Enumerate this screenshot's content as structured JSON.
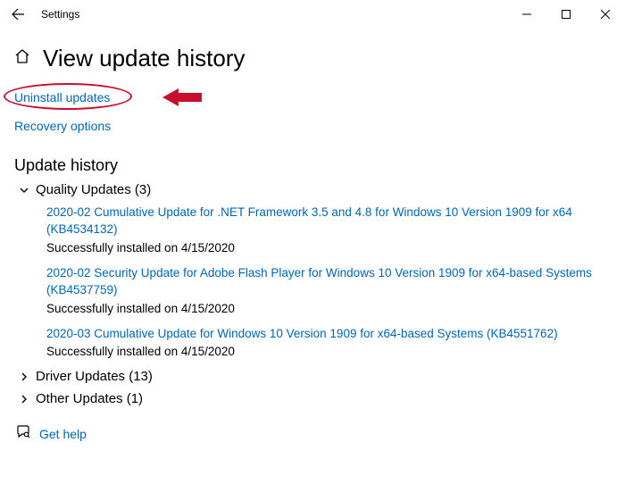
{
  "titlebar": {
    "title": "Settings"
  },
  "page": {
    "title": "View update history"
  },
  "links": {
    "uninstall": "Uninstall updates",
    "recovery": "Recovery options",
    "help": "Get help"
  },
  "history": {
    "heading": "Update history",
    "categories": [
      {
        "label": "Quality Updates (3)",
        "expanded": true,
        "items": [
          {
            "title": "2020-02 Cumulative Update for .NET Framework 3.5 and 4.8 for Windows 10 Version 1909 for x64 (KB4534132)",
            "status": "Successfully installed on 4/15/2020"
          },
          {
            "title": "2020-02 Security Update for Adobe Flash Player for Windows 10 Version 1909 for x64-based Systems (KB4537759)",
            "status": "Successfully installed on 4/15/2020"
          },
          {
            "title": "2020-03 Cumulative Update for Windows 10 Version 1909 for x64-based Systems (KB4551762)",
            "status": "Successfully installed on 4/15/2020"
          }
        ]
      },
      {
        "label": "Driver Updates (13)",
        "expanded": false,
        "items": []
      },
      {
        "label": "Other Updates (1)",
        "expanded": false,
        "items": []
      }
    ]
  }
}
